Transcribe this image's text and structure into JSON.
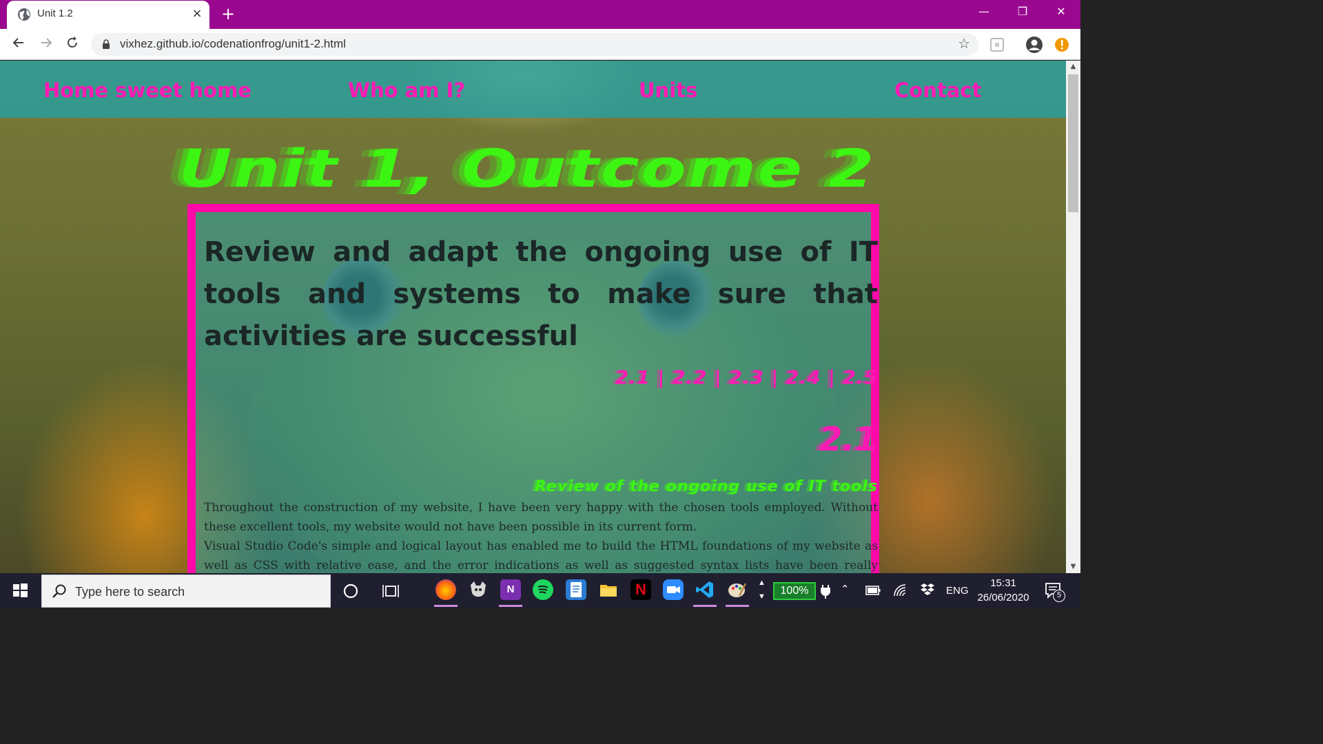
{
  "browser": {
    "tab_title": "Unit 1.2",
    "tab_close": "×",
    "new_tab": "+",
    "url": "vixhez.github.io/codenationfrog/unit1-2.html",
    "window_controls": {
      "minimize": "—",
      "restore": "❐",
      "close": "✕"
    }
  },
  "page": {
    "nav": {
      "home": "Home sweet home",
      "who": "Who am I?",
      "units": "Units",
      "contact": "Contact"
    },
    "unit_title": "Unit 1, Outcome 2",
    "heading": "Review and adapt the ongoing use of IT tools and systems to make sure that activities are successful",
    "outcome_links": "2.1 | 2.2 | 2.3 | 2.4 | 2.5",
    "section_number": "2.1",
    "section_subtitle": "Review of the ongoing use of IT tools",
    "paragraph_1": "Throughout the construction of my website, I have been very happy with the chosen tools employed. Without these excellent tools, my website would not have been possible in its current form.",
    "paragraph_2": "Visual Studio Code's simple and logical layout has enabled me to build the HTML foundations of my website as well as CSS with relative ease, and the error indications as well as suggested syntax lists have been really helpful."
  },
  "taskbar": {
    "search_placeholder": "Type here to search",
    "battery": "100%",
    "language": "ENG",
    "time": "15:31",
    "date": "26/06/2020",
    "notifications": "5",
    "apps": [
      "firefox-icon",
      "gimp-icon",
      "onenote-icon",
      "spotify-icon",
      "notepad-icon",
      "file-explorer-icon",
      "netflix-icon",
      "zoom-icon",
      "vscode-icon",
      "paint-icon"
    ]
  },
  "colors": {
    "titlebar": "#9a0890",
    "nav_link": "#ff1ab4",
    "accent_green": "#3df513",
    "panel_border": "#ff0aa8",
    "nav_bar": "#28a0a0"
  }
}
